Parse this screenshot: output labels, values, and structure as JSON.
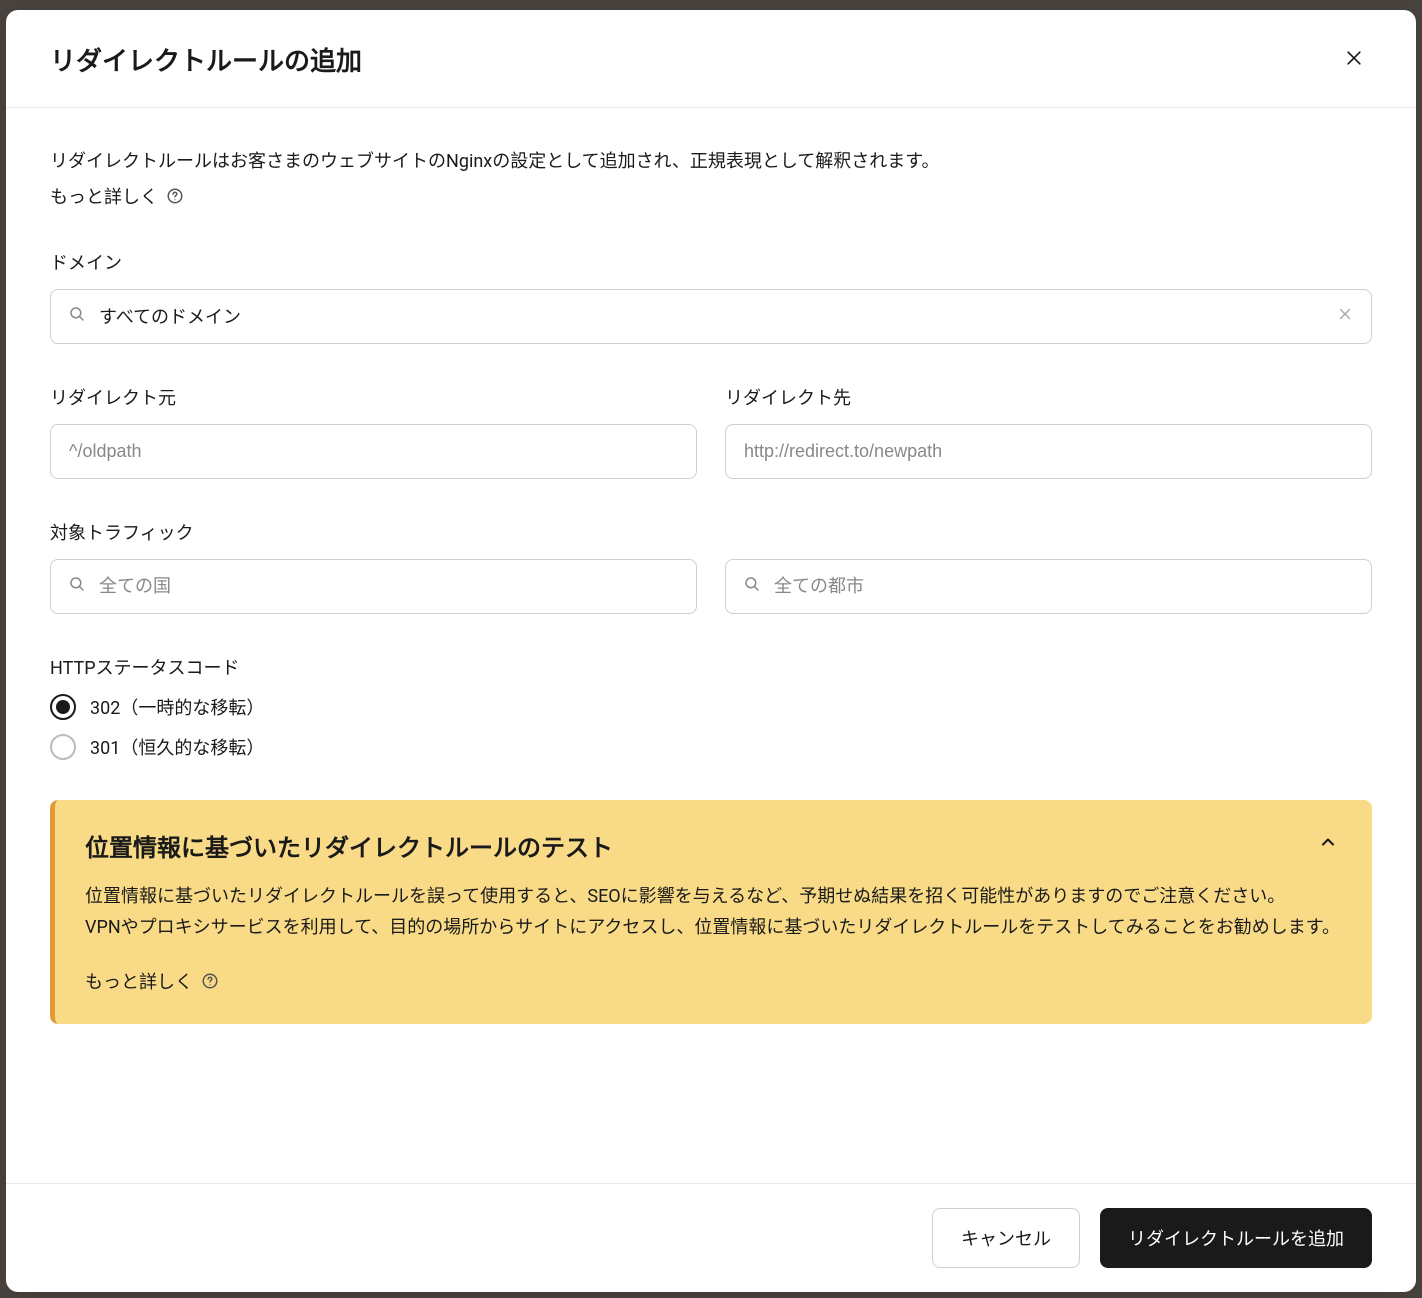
{
  "modal": {
    "title": "リダイレクトルールの追加",
    "description": "リダイレクトルールはお客さまのウェブサイトのNginxの設定として追加され、正規表現として解釈されます。",
    "learn_more_label": "もっと詳しく"
  },
  "form": {
    "domain": {
      "label": "ドメイン",
      "value": "すべてのドメイン"
    },
    "redirect_from": {
      "label": "リダイレクト元",
      "placeholder": "^/oldpath"
    },
    "redirect_to": {
      "label": "リダイレクト先",
      "placeholder": "http://redirect.to/newpath"
    },
    "target_traffic": {
      "label": "対象トラフィック",
      "country_placeholder": "全ての国",
      "city_placeholder": "全ての都市"
    },
    "http_status": {
      "label": "HTTPステータスコード",
      "option_302": "302（一時的な移転）",
      "option_301": "301（恒久的な移転）"
    }
  },
  "alert": {
    "title": "位置情報に基づいたリダイレクトルールのテスト",
    "body_line1": "位置情報に基づいたリダイレクトルールを誤って使用すると、SEOに影響を与えるなど、予期せぬ結果を招く可能性がありますのでご注意ください。",
    "body_line2": "VPNやプロキシサービスを利用して、目的の場所からサイトにアクセスし、位置情報に基づいたリダイレクトルールをテストしてみることをお勧めします。",
    "learn_more_label": "もっと詳しく"
  },
  "footer": {
    "cancel_label": "キャンセル",
    "submit_label": "リダイレクトルールを追加"
  }
}
